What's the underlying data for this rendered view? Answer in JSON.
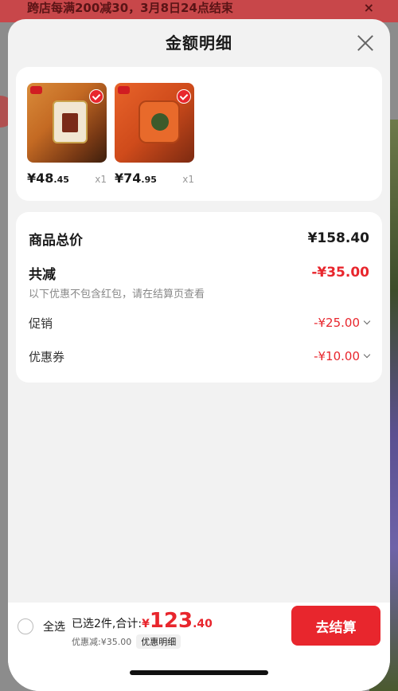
{
  "background": {
    "banner_text": "跨店每满200减30，3月8日24点结束",
    "banner_close": "×"
  },
  "sheet": {
    "title": "金额明细"
  },
  "products": [
    {
      "price_main": "¥48",
      "price_dec": ".45",
      "qty": "x1",
      "selected": true
    },
    {
      "price_main": "¥74",
      "price_dec": ".95",
      "qty": "x1",
      "selected": true
    }
  ],
  "summary": {
    "total_label": "商品总价",
    "total_value": "¥158.40",
    "reduce_label": "共减",
    "reduce_value": "-¥35.00",
    "reduce_note": "以下优惠不包含红包，请在结算页查看",
    "promo_label": "促销",
    "promo_value": "-¥25.00",
    "coupon_label": "优惠券",
    "coupon_value": "-¥10.00"
  },
  "bottom_bar": {
    "select_all": "全选",
    "selected_prefix": "已选2件,合计:",
    "currency": "¥",
    "total_int": "123",
    "total_dec": ".40",
    "discount_text": "优惠减:¥35.00",
    "discount_detail": "优惠明细",
    "checkout": "去结算"
  },
  "colors": {
    "accent": "#e8262d",
    "sheet_bg": "#f2f2f2"
  }
}
